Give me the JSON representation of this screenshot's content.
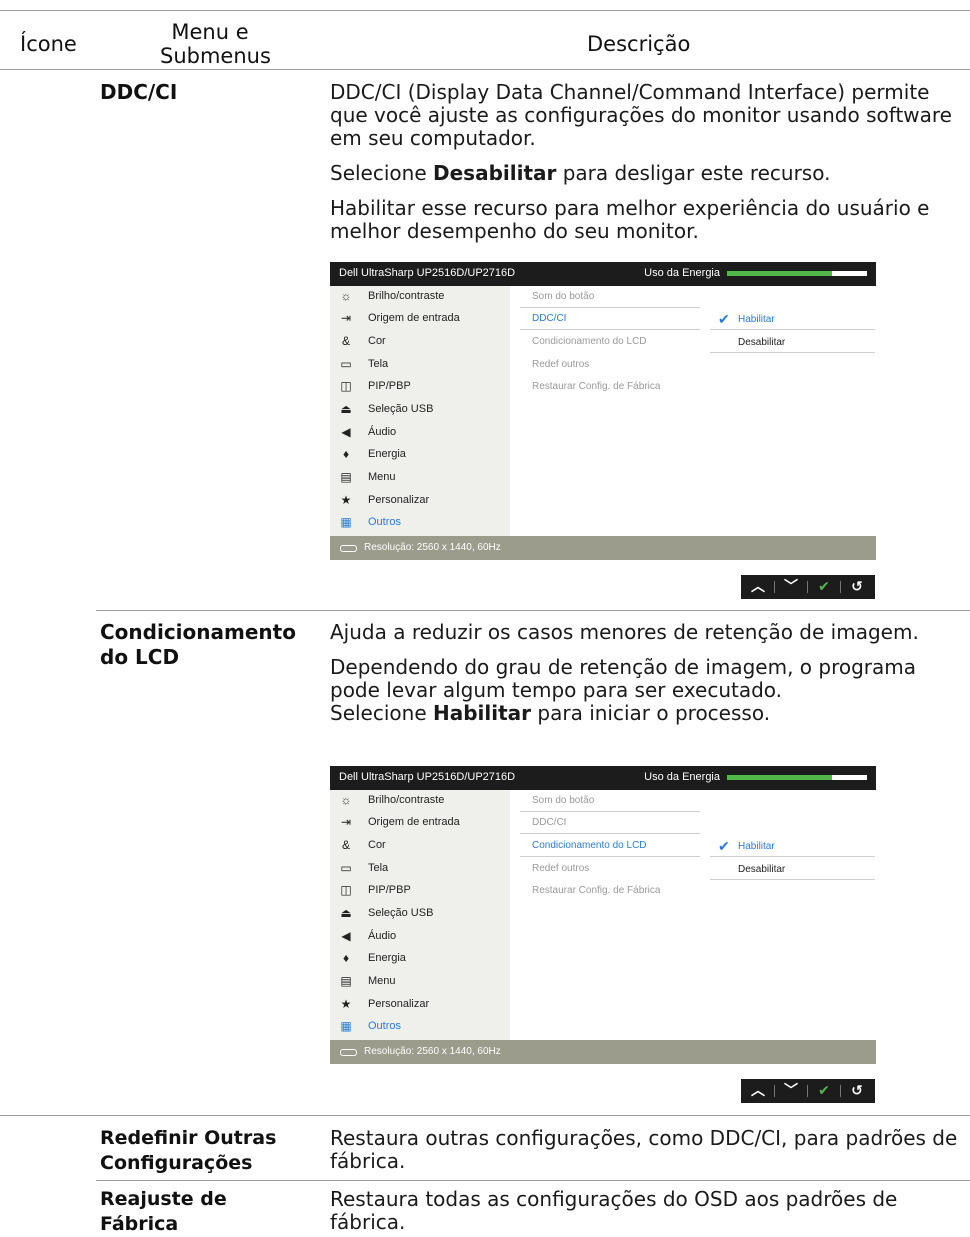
{
  "header": {
    "icon_col": "Ícone",
    "menu_col_line1": "Menu e",
    "menu_col_line2": "Submenus",
    "desc_col": "Descrição"
  },
  "rows": {
    "ddc": {
      "term": "DDC/CI",
      "p1": "DDC/CI (Display Data Channel/Command Interface) permite que você ajuste as configurações do monitor usando software em seu computador.",
      "p2_pre": "Selecione ",
      "p2_bold": "Desabilitar",
      "p2_post": " para desligar este recurso.",
      "p3": "Habilitar esse recurso para melhor experiência do usuário e melhor desempenho do seu monitor."
    },
    "lcd": {
      "term_line1": "Condicionamento",
      "term_line2": "do LCD",
      "p1": "Ajuda a reduzir os casos menores de retenção de imagem.",
      "p2": "Dependendo do grau de retenção de imagem, o programa pode levar algum tempo para ser executado.",
      "p3_pre": "Selecione ",
      "p3_bold": "Habilitar",
      "p3_post": " para iniciar o processo."
    },
    "reset_other": {
      "term_line1": "Redefinir Outras",
      "term_line2": "Configurações",
      "desc": "Restaura outras configurações, como DDC/CI, para padrões de fábrica."
    },
    "factory": {
      "term_line1": "Reajuste de",
      "term_line2": "Fábrica",
      "desc": "Restaura todas as configurações do OSD aos padrões de fábrica."
    }
  },
  "osd": {
    "title": "Dell UltraSharp UP2516D/UP2716D",
    "energy_label": "Uso da Energia",
    "energy_level": 0.75,
    "menu": [
      {
        "label": "Brilho/contraste",
        "icon": "brightness-icon"
      },
      {
        "label": "Origem de entrada",
        "icon": "input-source-icon"
      },
      {
        "label": "Cor",
        "icon": "color-icon"
      },
      {
        "label": "Tela",
        "icon": "display-icon"
      },
      {
        "label": "PIP/PBP",
        "icon": "pip-icon"
      },
      {
        "label": "Seleção USB",
        "icon": "usb-icon"
      },
      {
        "label": "Áudio",
        "icon": "audio-icon"
      },
      {
        "label": "Energia",
        "icon": "power-icon"
      },
      {
        "label": "Menu",
        "icon": "menu-icon"
      },
      {
        "label": "Personalizar",
        "icon": "star-icon"
      },
      {
        "label": "Outros",
        "icon": "others-icon"
      }
    ],
    "submenu": [
      "Som do botão",
      "DDC/CI",
      "Condicionamento do LCD",
      "Redef outros",
      "Restaurar Config. de Fábrica"
    ],
    "options": [
      "Habilitar",
      "Desabilitar"
    ],
    "resolution": "Resolução: 2560 x 1440, 60Hz",
    "colors": {
      "accent": "#2b7bd6",
      "energy": "#4fb848",
      "bottombar": "#9b9c8c"
    },
    "nav_icons": [
      "up-arrow-icon",
      "down-arrow-icon",
      "check-icon",
      "back-icon"
    ]
  }
}
